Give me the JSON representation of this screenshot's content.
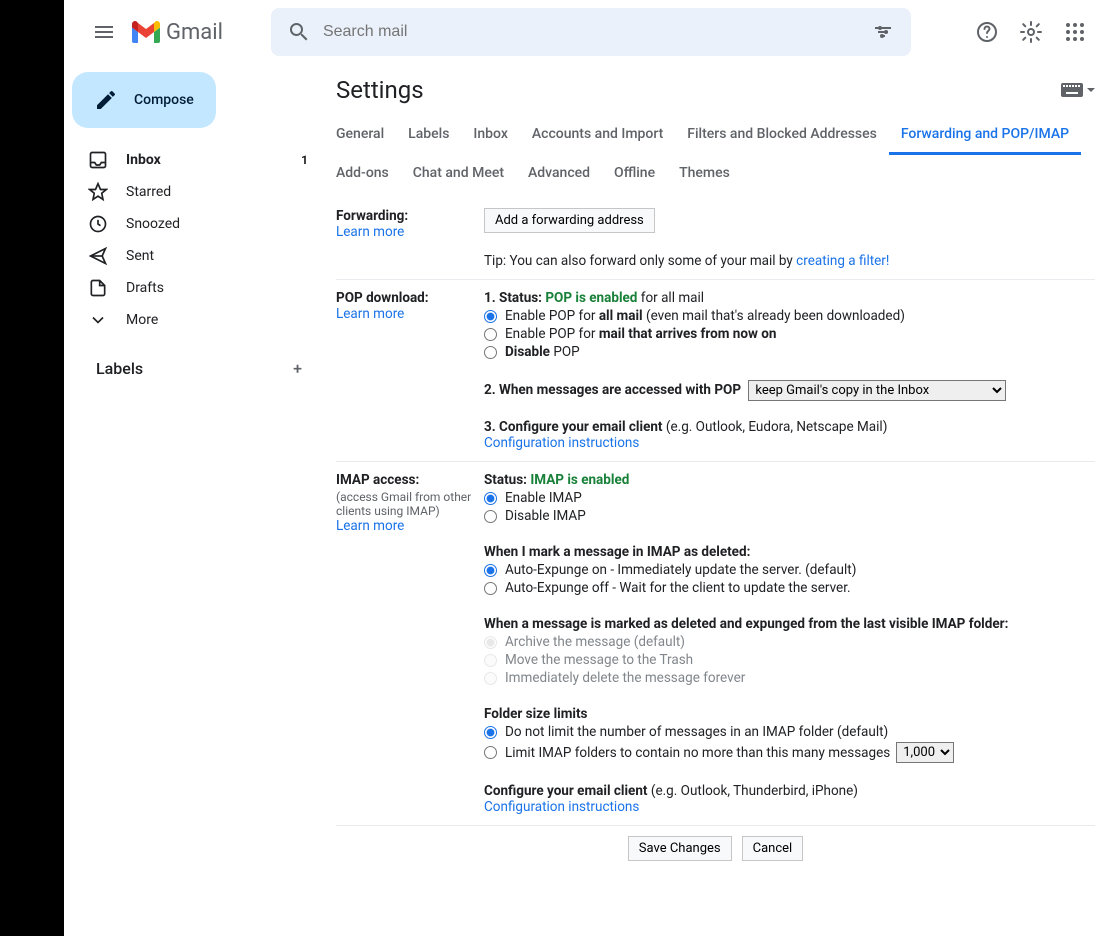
{
  "app": {
    "name": "Gmail"
  },
  "search": {
    "placeholder": "Search mail"
  },
  "compose": {
    "label": "Compose"
  },
  "nav": [
    {
      "label": "Inbox",
      "count": "1",
      "icon": "inbox",
      "active": true
    },
    {
      "label": "Starred",
      "count": "",
      "icon": "star"
    },
    {
      "label": "Snoozed",
      "count": "",
      "icon": "clock"
    },
    {
      "label": "Sent",
      "count": "",
      "icon": "send"
    },
    {
      "label": "Drafts",
      "count": "",
      "icon": "draft"
    },
    {
      "label": "More",
      "count": "",
      "icon": "expand"
    }
  ],
  "labelsHeader": "Labels",
  "settings": {
    "title": "Settings",
    "tabs": [
      "General",
      "Labels",
      "Inbox",
      "Accounts and Import",
      "Filters and Blocked Addresses",
      "Forwarding and POP/IMAP",
      "Add-ons",
      "Chat and Meet",
      "Advanced",
      "Offline",
      "Themes"
    ],
    "activeTab": 5
  },
  "forwarding": {
    "label": "Forwarding:",
    "learn": "Learn more",
    "addBtn": "Add a forwarding address",
    "tip": "Tip: You can also forward only some of your mail by ",
    "tipLink": "creating a filter!"
  },
  "pop": {
    "label": "POP download:",
    "learn": "Learn more",
    "status1": "1. Status: ",
    "statusEnabled": "POP is enabled",
    "statusSuffix": " for all mail",
    "opt1a": "Enable POP for ",
    "opt1b": "all mail",
    "opt1c": " (even mail that's already been downloaded)",
    "opt2a": "Enable POP for ",
    "opt2b": "mail that arrives from now on",
    "opt3a": "Disable",
    "opt3b": " POP",
    "step2": "2. When messages are accessed with POP",
    "dropdown": "keep Gmail's copy in the Inbox",
    "step3": "3. Configure your email client ",
    "step3hint": "(e.g. Outlook, Eudora, Netscape Mail)",
    "configLink": "Configuration instructions"
  },
  "imap": {
    "label": "IMAP access:",
    "sub": "(access Gmail from other clients using IMAP)",
    "learn": "Learn more",
    "statusLabel": "Status: ",
    "statusEnabled": "IMAP is enabled",
    "enable": "Enable IMAP",
    "disable": "Disable IMAP",
    "deletedHeader": "When I mark a message in IMAP as deleted:",
    "expungeOn": "Auto-Expunge on - Immediately update the server. (default)",
    "expungeOff": "Auto-Expunge off - Wait for the client to update the server.",
    "expungedHeader": "When a message is marked as deleted and expunged from the last visible IMAP folder:",
    "arch": "Archive the message (default)",
    "trash": "Move the message to the Trash",
    "delete": "Immediately delete the message forever",
    "folderHeader": "Folder size limits",
    "folderOpt1": "Do not limit the number of messages in an IMAP folder (default)",
    "folderOpt2": "Limit IMAP folders to contain no more than this many messages",
    "folderLimit": "1,000",
    "configLabel": "Configure your email client ",
    "configHint": "(e.g. Outlook, Thunderbird, iPhone)",
    "configLink": "Configuration instructions"
  },
  "footer": {
    "save": "Save Changes",
    "cancel": "Cancel"
  }
}
